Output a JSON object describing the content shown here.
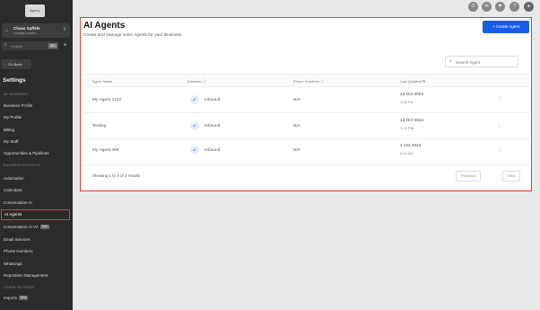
{
  "sidebar": {
    "logo": "Agency",
    "account": {
      "name": "Chase Saffels",
      "address": "Loading location..."
    },
    "search": {
      "placeholder": "Search",
      "shortcut": "⌘K"
    },
    "back_label": "← Go Back",
    "settings_title": "Settings",
    "sections": [
      {
        "label": "MY BUSINESS"
      },
      {
        "label": "BUSINESS SERVICES"
      },
      {
        "label": "OTHER SETTINGS"
      }
    ],
    "items": [
      {
        "label": "Business Profile"
      },
      {
        "label": "My Profile"
      },
      {
        "label": "Billing"
      },
      {
        "label": "My Staff"
      },
      {
        "label": "Opportunities & Pipelines"
      },
      {
        "label": "Automation"
      },
      {
        "label": "Calendars"
      },
      {
        "label": "Conversation AI"
      },
      {
        "label": "AI Agents"
      },
      {
        "label": "Conversation AI V2",
        "badge": "New"
      },
      {
        "label": "Email Services"
      },
      {
        "label": "Phone Numbers"
      },
      {
        "label": "WhatsApp"
      },
      {
        "label": "Reputation Management"
      },
      {
        "label": "Imports",
        "badge": "New"
      }
    ]
  },
  "header": {
    "title": "AI Agents",
    "subtitle": "Create and manage voice Agents for your Business",
    "create_button": "+ Create Agent"
  },
  "table": {
    "search_placeholder": "Search Agent",
    "columns": [
      "Agent Name",
      "Direction",
      "Phone Numbers",
      "Last Updated"
    ],
    "rows": [
      {
        "name": "My Agent 2132",
        "direction": "Inbound",
        "phone": "N/A",
        "date": "13 Oct 2024",
        "time": "1:00 PM"
      },
      {
        "name": "Testing",
        "direction": "Inbound",
        "phone": "N/A",
        "date": "13 Oct 2024",
        "time": "1:09 PM"
      },
      {
        "name": "My Agent 488",
        "direction": "Inbound",
        "phone": "N/A",
        "date": "4 Oct 2024",
        "time": "8:50 AM"
      }
    ],
    "footer": "Showing 1 to 3 of 3 results",
    "prev_label": "Previous",
    "next_label": "Next"
  }
}
